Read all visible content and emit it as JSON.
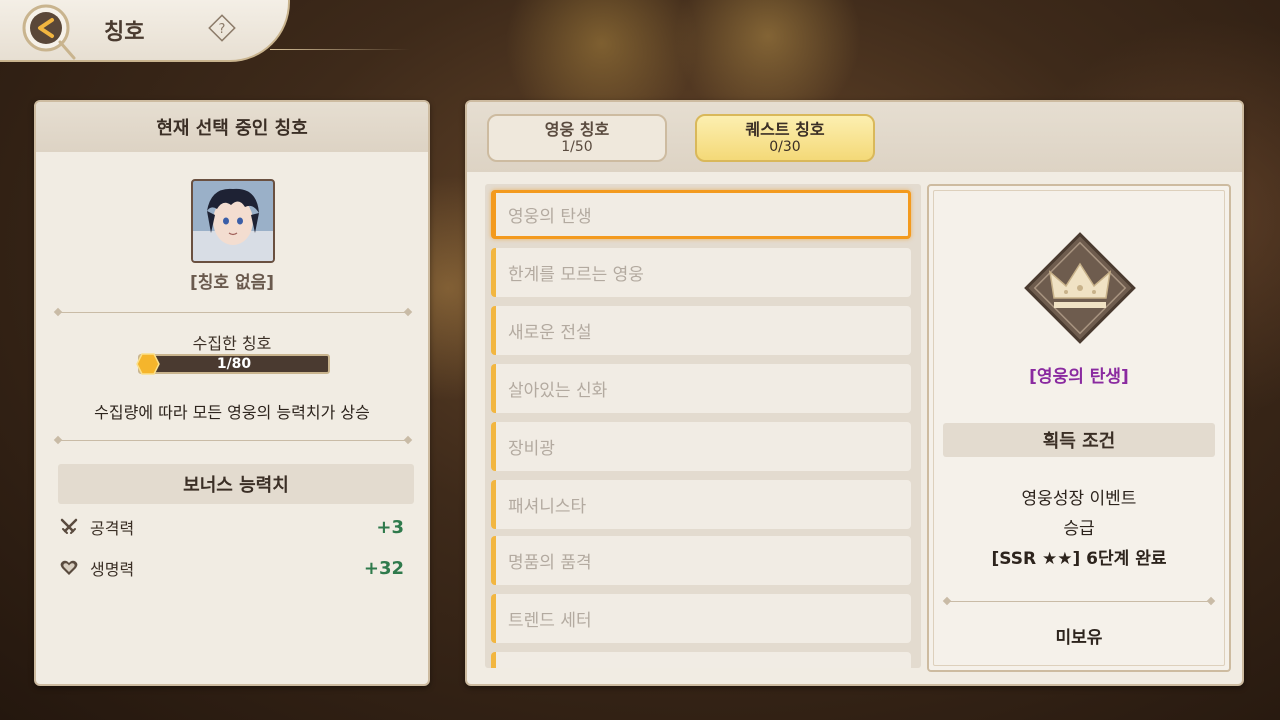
{
  "header": {
    "title": "칭호",
    "help_symbol": "?"
  },
  "left_panel": {
    "title": "현재 선택 중인 칭호",
    "current_title_name": "[칭호 없음]",
    "collected_label": "수집한 칭호",
    "collected_progress": "1/80",
    "collected_fraction": 0.0125,
    "collect_description": "수집량에 따라 모든 영웅의 능력치가 상승",
    "bonus_header": "보너스 능력치",
    "stats": [
      {
        "label": "공격력",
        "value": "+3",
        "icon": "crossed-swords-icon"
      },
      {
        "label": "생명력",
        "value": "+32",
        "icon": "heart-icon"
      }
    ]
  },
  "tabs": [
    {
      "label": "영웅 칭호",
      "count": "1/50",
      "active": false
    },
    {
      "label": "퀘스트 칭호",
      "count": "0/30",
      "active": true
    }
  ],
  "title_list": [
    "영웅의 탄생",
    "한계를 모르는 영웅",
    "새로운 전설",
    "살아있는 신화",
    "장비광",
    "패셔니스타",
    "명품의 품격",
    "트렌드 세터"
  ],
  "detail": {
    "name": "[영웅의 탄생]",
    "condition_header": "획득 조건",
    "condition_line1": "영웅성장 이벤트",
    "condition_line2": "승급",
    "condition_line3": "[SSR ★★] 6단계 완료",
    "status": "미보유"
  },
  "colors": {
    "accent_orange": "#f39a1e",
    "tab_active": "#f4d978",
    "stat_green": "#2f7a4c",
    "title_purple": "#8a2aa0"
  }
}
